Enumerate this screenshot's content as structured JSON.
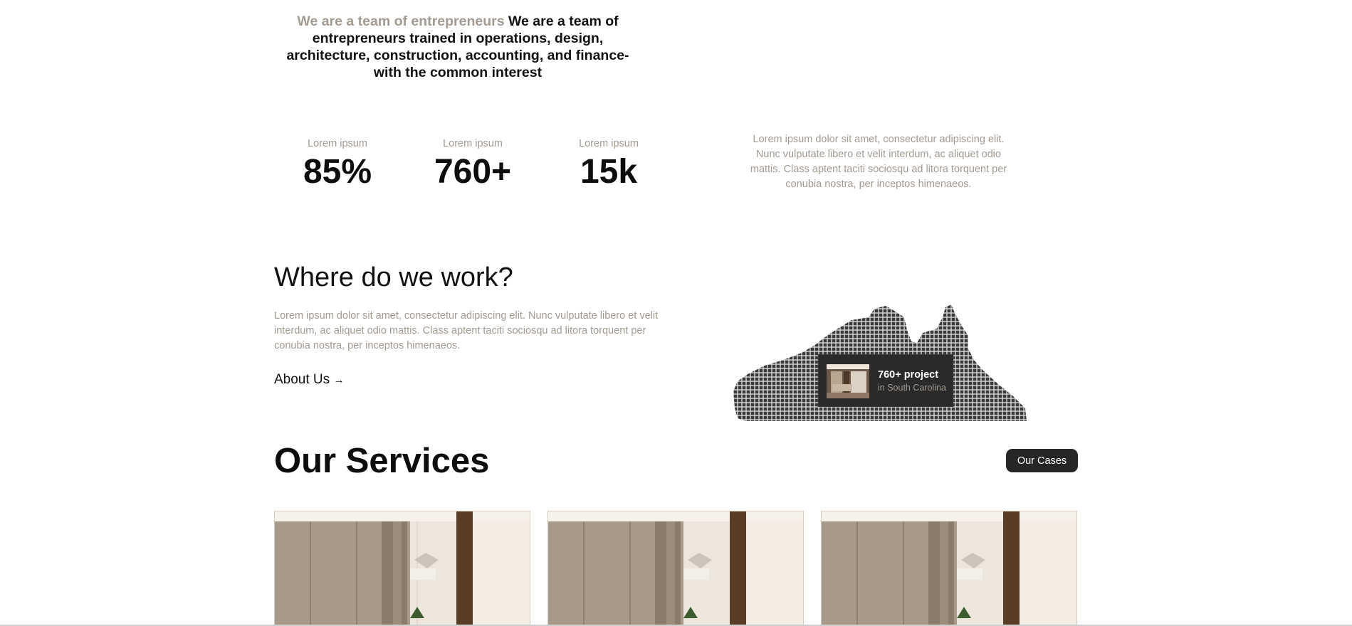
{
  "intro": {
    "muted": "We are a team of entrepreneurs",
    "text": "We are a team of entrepreneurs trained in operations, design, architecture, construction, accounting, and finance-with the common interest"
  },
  "stats": [
    {
      "label": "Lorem ipsum",
      "value": "85%"
    },
    {
      "label": "Lorem ipsum",
      "value": "760+"
    },
    {
      "label": "Lorem ipsum",
      "value": "15k"
    }
  ],
  "stats_side_text": "Lorem ipsum dolor sit amet, consectetur adipiscing elit. Nunc vulputate libero et velit interdum, ac aliquet odio mattis. Class aptent taciti sociosqu ad litora torquent per conubia nostra, per inceptos himenaeos.",
  "where": {
    "title": "Where do we work?",
    "body": "Lorem ipsum dolor sit amet, consectetur adipiscing elit. Nunc vulputate libero et velit interdum, ac aliquet odio mattis. Class aptent taciti sociosqu ad litora torquent per conubia nostra, per inceptos himenaeos.",
    "link_label": "About Us",
    "link_icon": "arrow-right-icon",
    "badge_title": "760+ project",
    "badge_subtitle": "in South Carolina"
  },
  "services": {
    "title": "Our Services",
    "button_label": "Our Cases",
    "cards": [
      {
        "image": "interior-room"
      },
      {
        "image": "interior-room"
      },
      {
        "image": "interior-room"
      }
    ]
  },
  "colors": {
    "muted": "#a39a91",
    "dark": "#262626",
    "text": "#0d0d0d"
  }
}
